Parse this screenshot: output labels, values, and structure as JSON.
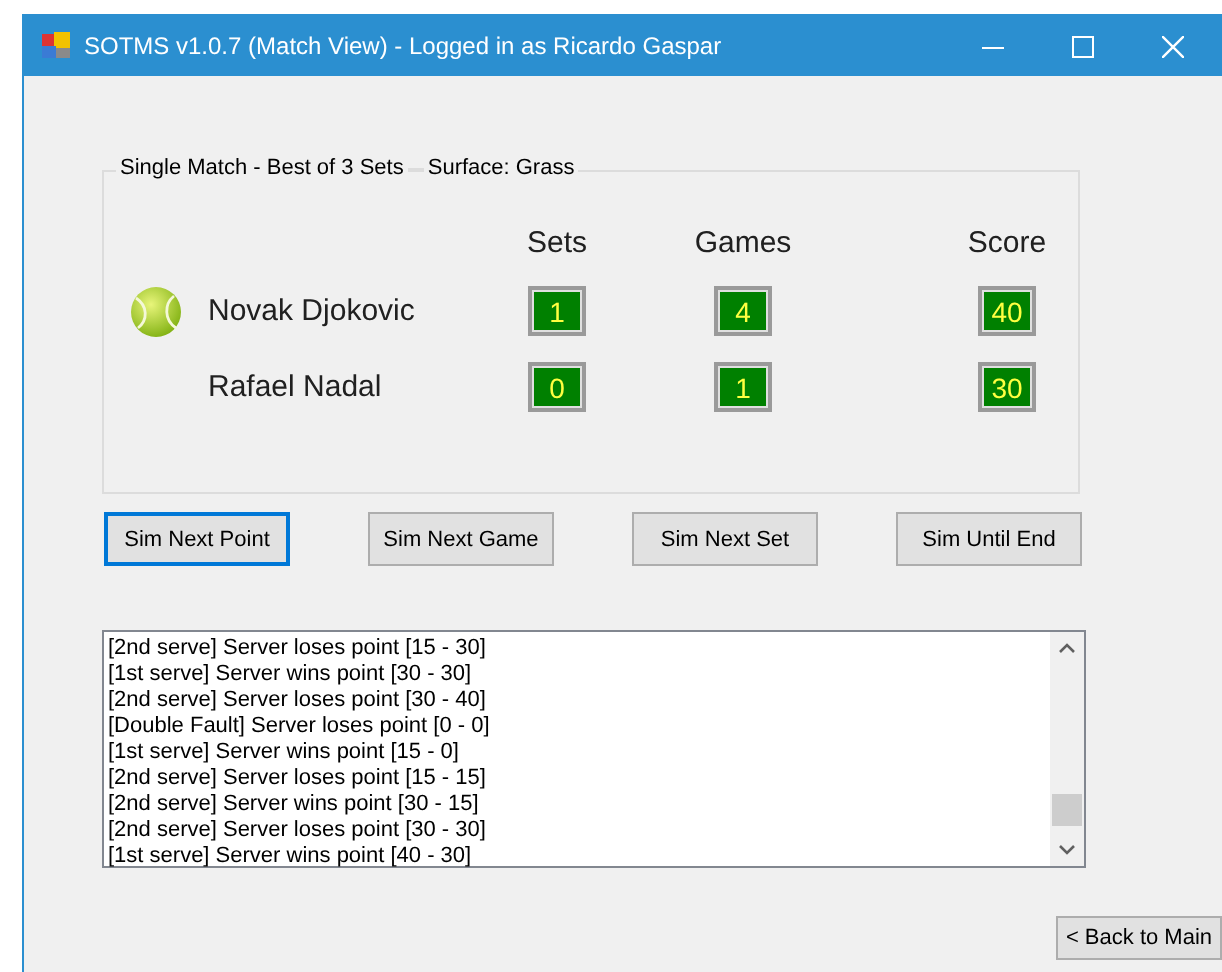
{
  "window": {
    "title": "SOTMS v1.0.7 (Match View) - Logged in as Ricardo Gaspar"
  },
  "match": {
    "format": "Single Match - Best of 3 Sets",
    "surface": "Surface:  Grass",
    "columns": [
      "Sets",
      "Games",
      "Score"
    ],
    "players": [
      {
        "name": "Novak Djokovic",
        "serving": true,
        "sets": "1",
        "games": "4",
        "score": "40"
      },
      {
        "name": "Rafael Nadal",
        "serving": false,
        "sets": "0",
        "games": "1",
        "score": "30"
      }
    ]
  },
  "buttons": [
    {
      "label": "Sim Next Point",
      "focused": true
    },
    {
      "label": "Sim Next Game",
      "focused": false
    },
    {
      "label": "Sim Next Set",
      "focused": false
    },
    {
      "label": "Sim Until End",
      "focused": false
    }
  ],
  "log": [
    "[2nd serve] Server loses point [15 - 30]",
    "[1st serve] Server wins point [30 - 30]",
    "[2nd serve] Server loses point [30 - 40]",
    "[Double Fault] Server loses point [0 - 0]",
    "[1st serve] Server wins point [15 - 0]",
    "[2nd serve] Server loses point [15 - 15]",
    "[2nd serve] Server wins point [30 - 15]",
    "[2nd serve] Server loses point [30 - 30]",
    "[1st serve] Server wins point [40 - 30]"
  ],
  "back_button": {
    "label": "< Back to Main"
  }
}
